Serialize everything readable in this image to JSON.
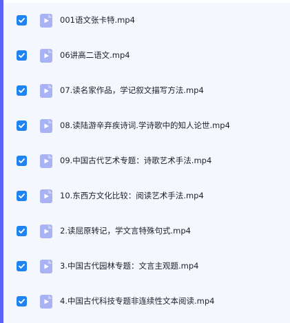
{
  "files": [
    {
      "name": "001语文张卡特.mp4",
      "checked": true
    },
    {
      "name": "06讲高二语文.mp4",
      "checked": true
    },
    {
      "name": "07.读名家作品，学记叙文描写方法.mp4",
      "checked": true
    },
    {
      "name": "08.读陆游辛弃疾诗词.学诗歌中的知人论世.mp4",
      "checked": true
    },
    {
      "name": "09.中国古代艺术专题：诗歌艺术手法.mp4",
      "checked": true
    },
    {
      "name": "10.东西方文化比较：阅读艺术手法.mp4",
      "checked": true
    },
    {
      "name": "2.读屈原转记，学文言特殊句式.mp4",
      "checked": true
    },
    {
      "name": "3.中国古代园林专题：文言主观题.mp4",
      "checked": true
    },
    {
      "name": "4.中国古代科技专题非连续性文本阅读.mp4",
      "checked": true
    }
  ],
  "icons": {
    "checkbox": "checkbox-checked-icon",
    "file": "video-file-icon"
  },
  "colors": {
    "accent": "#5a63f6",
    "checkbox": "#1f83f2",
    "file_icon": "#a9b3f4",
    "panel": "#f4f8fe"
  }
}
